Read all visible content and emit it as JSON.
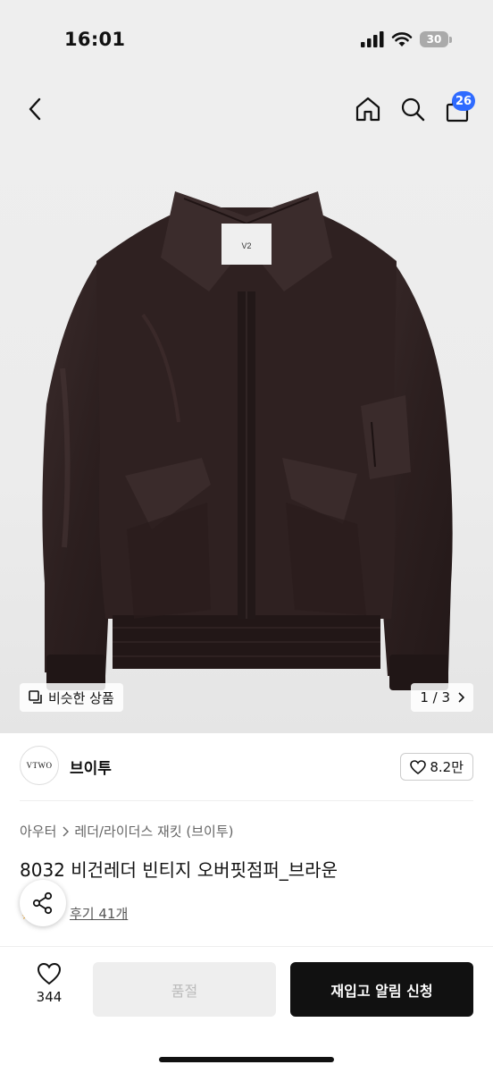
{
  "status_bar": {
    "time": "16:01",
    "battery": "30"
  },
  "header": {
    "cart_count": "26"
  },
  "gallery": {
    "similar_label": "비슷한 상품",
    "page_counter": "1 / 3"
  },
  "brand": {
    "logo_text": "VTWO",
    "name": "브이투",
    "likes": "8.2만"
  },
  "product": {
    "breadcrumb": [
      "아우터",
      "레더/라이더스 재킷 (브이투)"
    ],
    "title": "8032 비건레더 빈티지 오버핏점퍼_브라운",
    "review_link": "후기 41개"
  },
  "bottom_bar": {
    "wish_count": "344",
    "soldout_label": "품절",
    "restock_label": "재입고 알림 신청"
  },
  "colors": {
    "accent_badge": "#2f6bff",
    "primary_button": "#111111",
    "disabled_button": "#eeeeee",
    "jacket_leather": "#2e2020"
  },
  "icons": [
    "back-arrow-icon",
    "home-icon",
    "search-icon",
    "cart-icon",
    "similar-items-icon",
    "chevron-right-icon",
    "heart-icon",
    "share-icon"
  ]
}
